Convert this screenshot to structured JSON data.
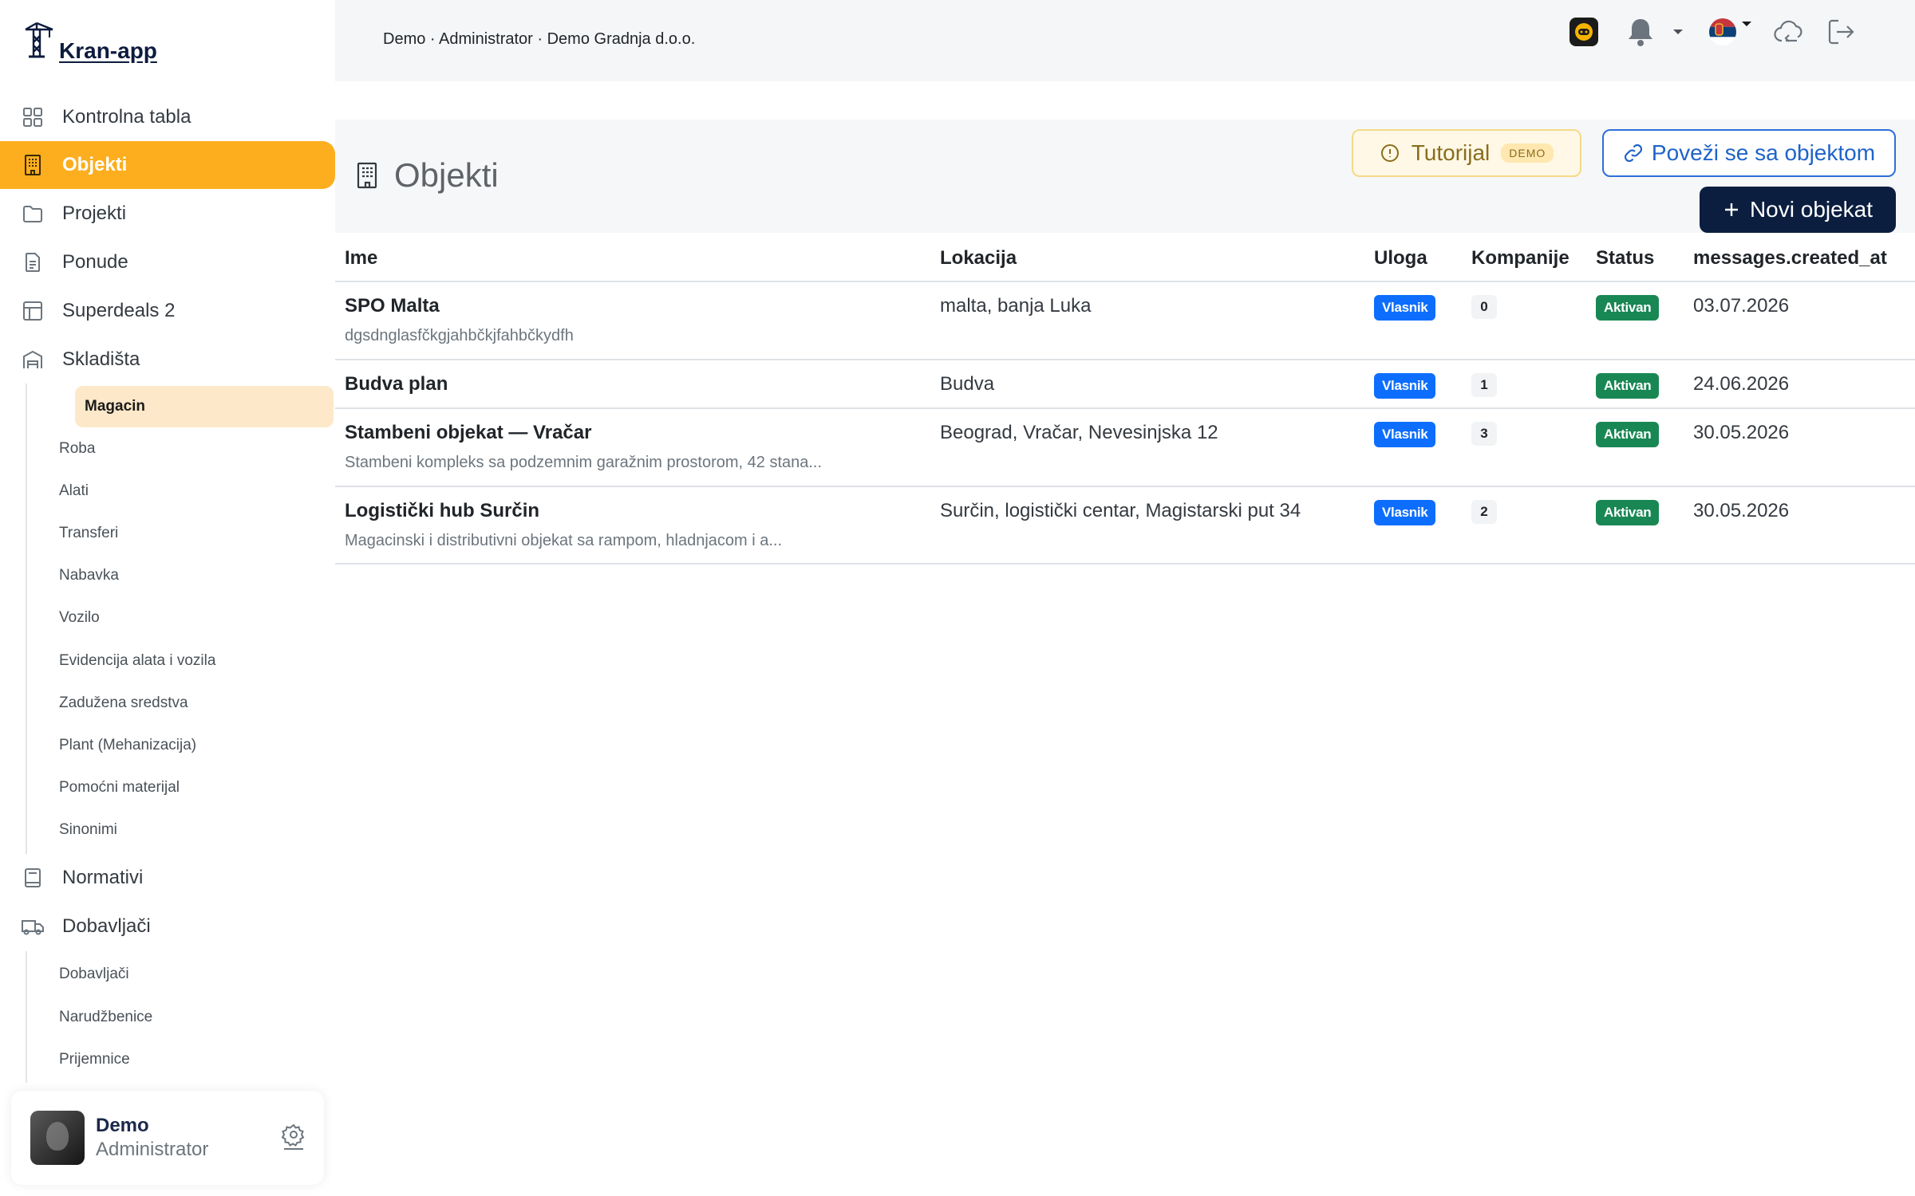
{
  "app": {
    "logo_text": "Kran-app"
  },
  "sidebar": {
    "items": [
      {
        "label": "Kontrolna tabla",
        "icon": "grid-icon"
      },
      {
        "label": "Objekti",
        "icon": "building-icon",
        "active": true
      },
      {
        "label": "Projekti",
        "icon": "folder-icon"
      },
      {
        "label": "Ponude",
        "icon": "document-icon"
      },
      {
        "label": "Superdeals 2",
        "icon": "table-icon"
      },
      {
        "label": "Skladišta",
        "icon": "warehouse-icon"
      }
    ],
    "skladista_sub": [
      "Magacin",
      "Roba",
      "Alati",
      "Transferi",
      "Nabavka",
      "Vozilo",
      "Evidencija alata i vozila",
      "Zadužena sredstva",
      "Plant (Mehanizacija)",
      "Pomoćni materijal",
      "Sinonimi"
    ],
    "items2": [
      {
        "label": "Normativi",
        "icon": "book-icon"
      },
      {
        "label": "Dobavljači",
        "icon": "truck-icon"
      }
    ],
    "dobavljaci_sub": [
      "Dobavljači",
      "Narudžbenice",
      "Prijemnice"
    ]
  },
  "profile": {
    "name": "Demo",
    "role": "Administrator"
  },
  "topbar": {
    "breadcrumb": "Demo · Administrator · Demo Gradnja d.o.o."
  },
  "page": {
    "title": "Objekti",
    "tutorial_label": "Tutorijal",
    "demo_badge": "DEMO",
    "connect_label": "Poveži se sa objektom",
    "new_label": "Novi objekat"
  },
  "table": {
    "columns": [
      "Ime",
      "Lokacija",
      "Uloga",
      "Kompanije",
      "Status",
      "messages.created_at"
    ],
    "rows": [
      {
        "name": "SPO Malta",
        "desc": "dgsdnglasfčkgjahbčkjfahbčkydfh",
        "location": "malta, banja Luka",
        "role": "Vlasnik",
        "companies": "0",
        "status": "Aktivan",
        "created": "03.07.2026"
      },
      {
        "name": "Budva plan",
        "desc": "",
        "location": "Budva",
        "role": "Vlasnik",
        "companies": "1",
        "status": "Aktivan",
        "created": "24.06.2026"
      },
      {
        "name": "Stambeni objekat — Vračar",
        "desc": "Stambeni kompleks sa podzemnim garažnim prostorom, 42 stana...",
        "location": "Beograd, Vračar, Nevesinjska 12",
        "role": "Vlasnik",
        "companies": "3",
        "status": "Aktivan",
        "created": "30.05.2026"
      },
      {
        "name": "Logistički hub Surčin",
        "desc": "Magacinski i distributivni objekat sa rampom, hladnjacom i a...",
        "location": "Surčin, logistički centar, Magistarski put 34",
        "role": "Vlasnik",
        "companies": "2",
        "status": "Aktivan",
        "created": "30.05.2026"
      }
    ]
  },
  "colors": {
    "accent": "#fcae1e",
    "primary_dark": "#0b1e3f",
    "link_blue": "#1f63c9",
    "badge_blue": "#0d6efd",
    "badge_green": "#198754"
  }
}
